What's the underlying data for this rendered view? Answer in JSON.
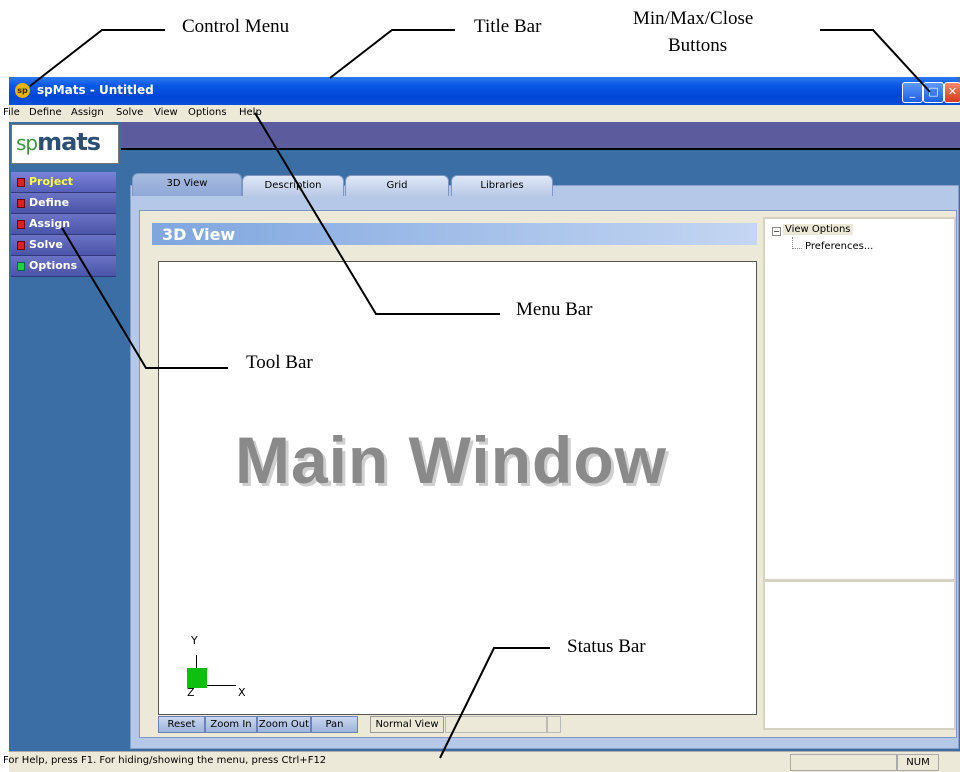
{
  "callouts": {
    "control_menu": "Control Menu",
    "title_bar": "Title Bar",
    "min_max_close": "Min/Max/Close",
    "buttons": "Buttons",
    "menu_bar": "Menu Bar",
    "tool_bar": "Tool Bar",
    "status_bar": "Status Bar"
  },
  "window": {
    "title": "spMats - Untitled",
    "icon_label": "sp",
    "min_glyph": "_",
    "max_glyph": "□",
    "close_glyph": "✕"
  },
  "menu": [
    "File",
    "Define",
    "Assign",
    "Solve",
    "View",
    "Options",
    "Help"
  ],
  "logo": {
    "sp": "sp",
    "mats": "mats"
  },
  "toolbar_items": [
    "Project",
    "Define",
    "Assign",
    "Solve",
    "Options"
  ],
  "tabs": [
    "3D View",
    "Description",
    "Grid",
    "Libraries"
  ],
  "view": {
    "header": "3D View",
    "main_label": "Main Window",
    "axis_y": "Y",
    "axis_x": "X",
    "axis_z": "Z"
  },
  "view_buttons": [
    "Reset",
    "Zoom In",
    "Zoom Out",
    "Pan"
  ],
  "view_mode": "Normal View",
  "tree": {
    "toggle": "−",
    "root": "View Options",
    "child": "Preferences..."
  },
  "status": {
    "text": "For Help, press F1. For hiding/showing the menu, press Ctrl+F12",
    "num": "NUM"
  }
}
